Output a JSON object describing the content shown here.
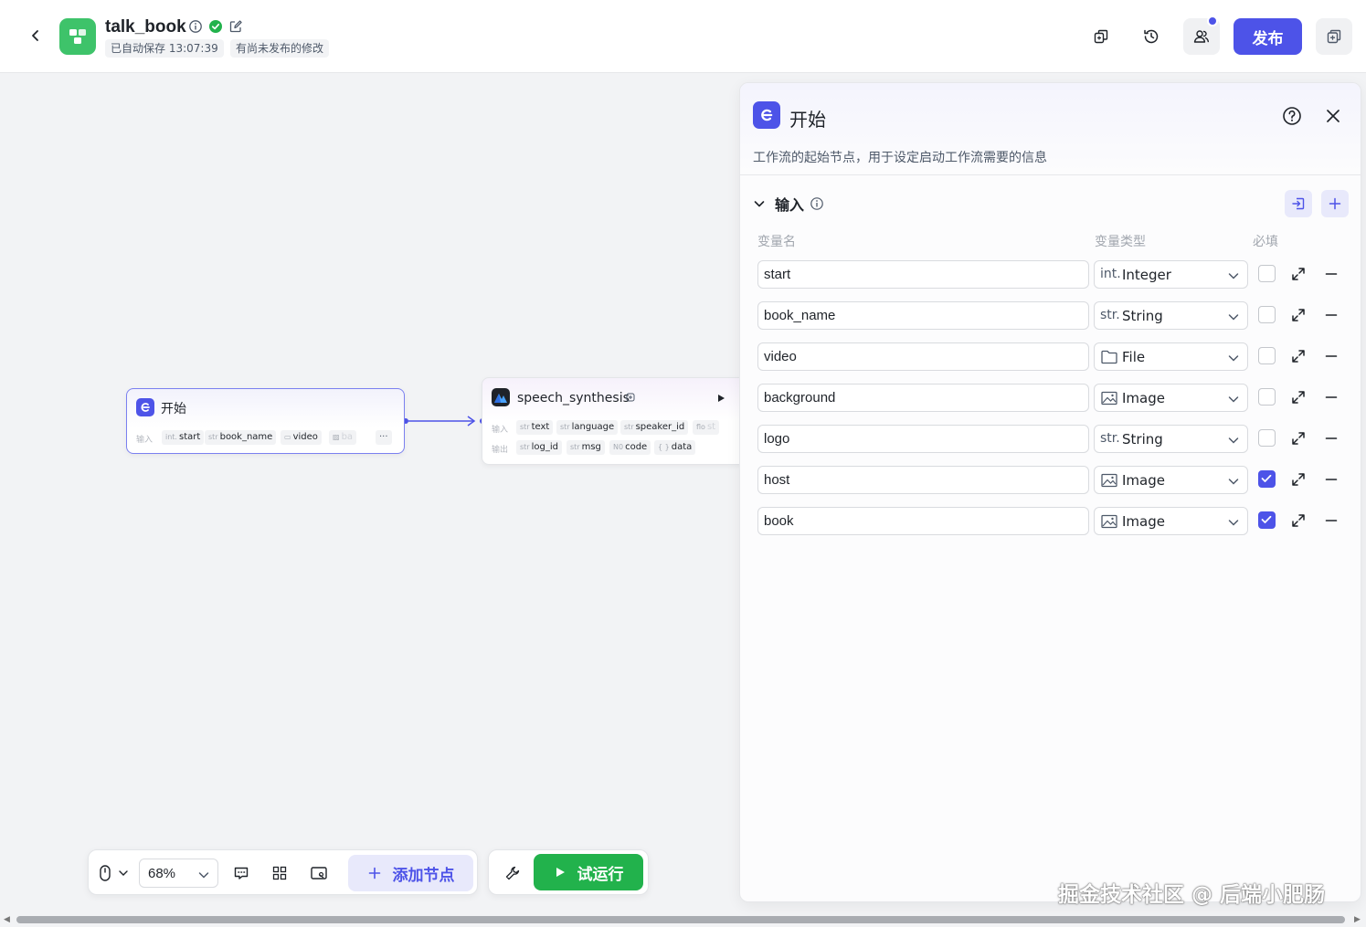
{
  "header": {
    "app_name": "talk_book",
    "autosave": "已自动保存 13:07:39",
    "unpublished": "有尚未发布的修改",
    "publish_label": "发布"
  },
  "canvas": {
    "start_node": {
      "title": "开始",
      "input_label": "输入",
      "inputs": [
        {
          "type": "int.",
          "name": "start"
        },
        {
          "type": "str",
          "name": "book_name"
        },
        {
          "type": "file",
          "name": "video"
        },
        {
          "type": "image",
          "name": "ba"
        }
      ],
      "more": "···"
    },
    "speech_node": {
      "title": "speech_synthesis",
      "input_label": "输入",
      "output_label": "输出",
      "inputs": [
        {
          "type": "str",
          "name": "text"
        },
        {
          "type": "str",
          "name": "language"
        },
        {
          "type": "str",
          "name": "speaker_id"
        },
        {
          "type": "flo",
          "name": "st"
        }
      ],
      "outputs": [
        {
          "type": "str",
          "name": "log_id"
        },
        {
          "type": "str",
          "name": "msg"
        },
        {
          "type": "N0",
          "name": "code"
        },
        {
          "type": "{ }",
          "name": "data"
        }
      ]
    }
  },
  "panel": {
    "title": "开始",
    "description": "工作流的起始节点，用于设定启动工作流需要的信息",
    "section_label": "输入",
    "col_name": "变量名",
    "col_type": "变量类型",
    "col_required": "必填",
    "variables": [
      {
        "name": "start",
        "type_icon": "int.",
        "type": "Integer",
        "required": false
      },
      {
        "name": "book_name",
        "type_icon": "str.",
        "type": "String",
        "required": false
      },
      {
        "name": "video",
        "type_icon": "folder-icon",
        "type": "File",
        "required": false
      },
      {
        "name": "background",
        "type_icon": "image-icon",
        "type": "Image",
        "required": false
      },
      {
        "name": "logo",
        "type_icon": "str.",
        "type": "String",
        "required": false
      },
      {
        "name": "host",
        "type_icon": "image-icon",
        "type": "Image",
        "required": true
      },
      {
        "name": "book",
        "type_icon": "image-icon",
        "type": "Image",
        "required": true
      }
    ]
  },
  "toolbar": {
    "zoom": "68%",
    "add_node_label": "添加节点",
    "run_label": "试运行"
  },
  "watermark": "掘金技术社区 @ 后端小肥肠",
  "colors": {
    "accent": "#4d53e8",
    "run_green": "#22b24c",
    "logo_green": "#3ec36a"
  }
}
